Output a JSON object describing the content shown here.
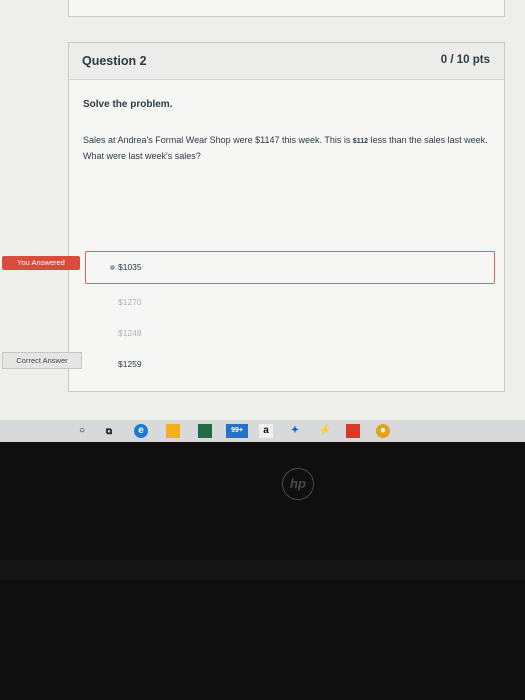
{
  "question": {
    "title": "Question 2",
    "points": "0 / 10 pts",
    "instruction": "Solve the problem.",
    "text_part1": "Sales at Andrea's Formal Wear Shop were $1147 this week. This is",
    "text_amount": "$112",
    "text_part2": "less than the sales last week. What were last week's sales?"
  },
  "flags": {
    "you_answered": "You Answered",
    "correct_answer": "Correct Answer"
  },
  "choices": [
    "$1035",
    "$1270",
    "$1248",
    "$1259"
  ],
  "taskbar": {
    "mail_badge": "99+",
    "amazon_glyph": "a"
  },
  "colors": {
    "wrong": "#d94c3d",
    "text": "#2d3b45",
    "taskbar": "#d7d9da"
  }
}
